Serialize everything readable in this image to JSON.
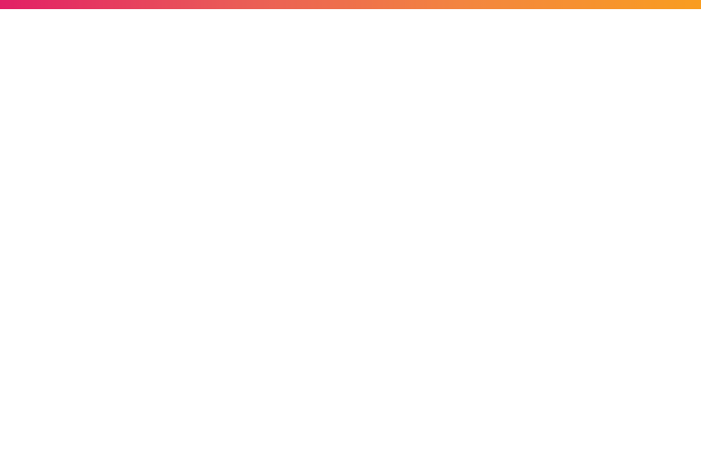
{
  "theme": {
    "background": "#ffffff",
    "accent_gradient": [
      "#e21f66",
      "#ea5b57",
      "#f3863f",
      "#f99d20"
    ]
  },
  "content": {}
}
